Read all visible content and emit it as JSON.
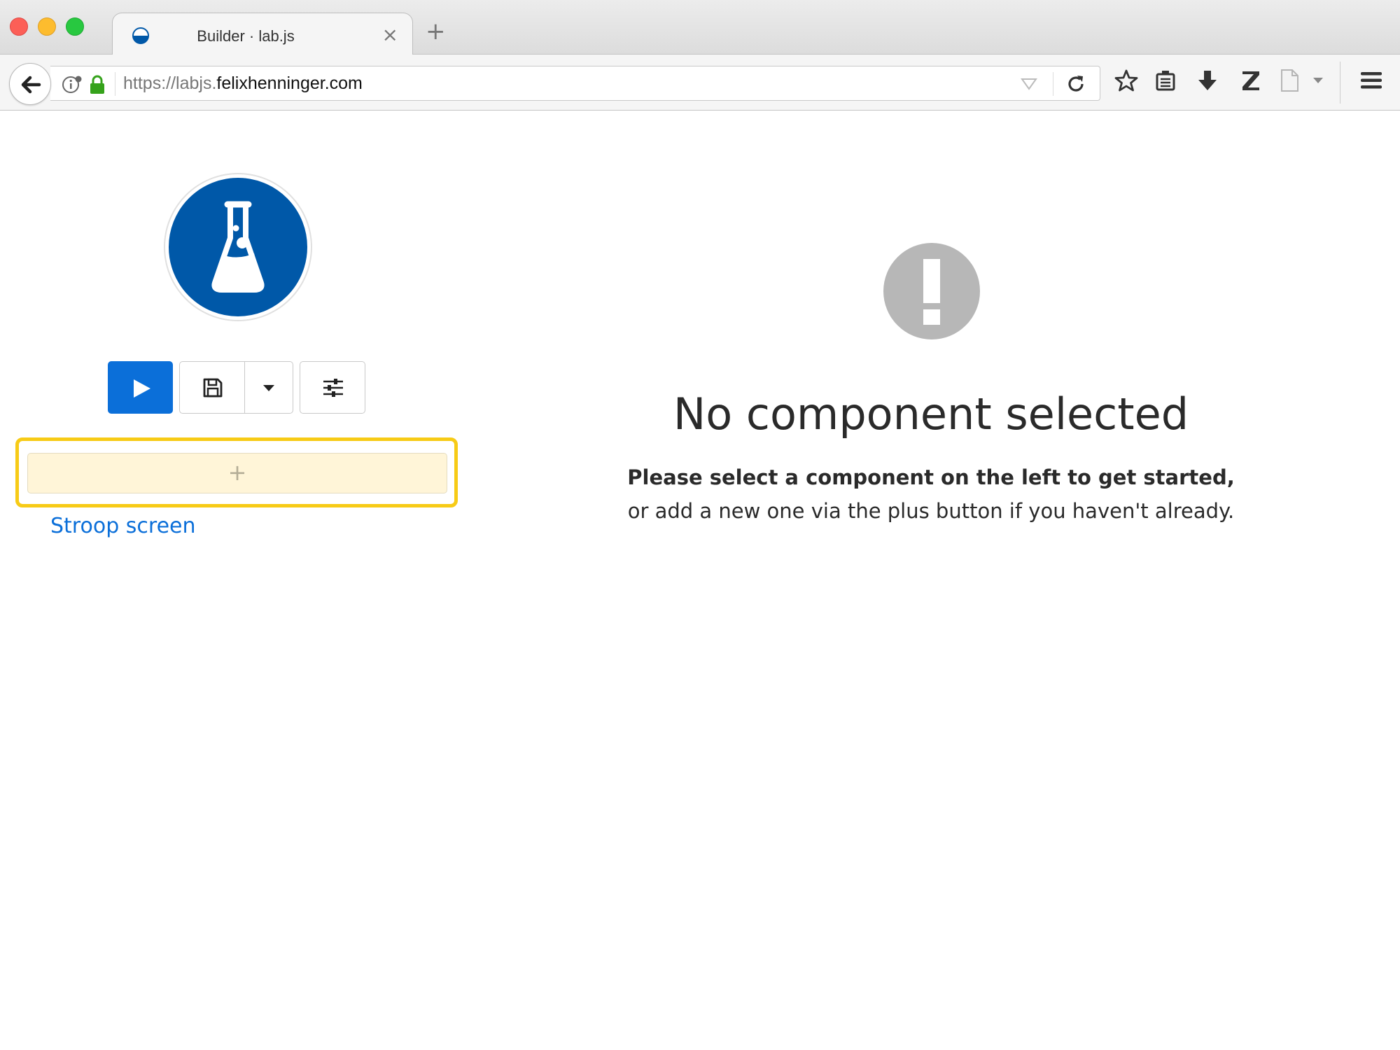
{
  "browser": {
    "tab": {
      "title": "Builder · lab.js",
      "favicon": "labjs-favicon-icon",
      "close_glyph": "×"
    },
    "new_tab_glyph": "+",
    "url": {
      "scheme_sub": "https://labjs.",
      "domain": "felixhenninger.com"
    },
    "toolbar_icons": [
      "back-arrow-icon",
      "info-icon",
      "lock-icon",
      "dropdown-icon",
      "reload-icon",
      "star-icon",
      "reading-list-icon",
      "download-icon",
      "zotero-icon",
      "document-icon",
      "chevron-down-icon",
      "hamburger-menu-icon"
    ]
  },
  "sidebar": {
    "logo_icon": "flask-icon",
    "buttons": {
      "run": "play-icon",
      "save": "floppy-disk-icon",
      "save_options": "caret-down-icon",
      "options": "sliders-icon"
    },
    "add_glyph": "+",
    "components": [
      {
        "label": "Stroop screen"
      }
    ]
  },
  "main": {
    "icon": "exclamation-icon",
    "title": "No component selected",
    "message_line1": "Please select a component on the left to get started,",
    "message_line2": "or add a new one via the plus button if you haven't already."
  },
  "colors": {
    "accent": "#0b6fd9",
    "logo_blue": "#0058a8",
    "highlight_yellow": "#f7cb16",
    "add_bg": "#fff5d8",
    "alert_grey": "#b7b7b7"
  }
}
